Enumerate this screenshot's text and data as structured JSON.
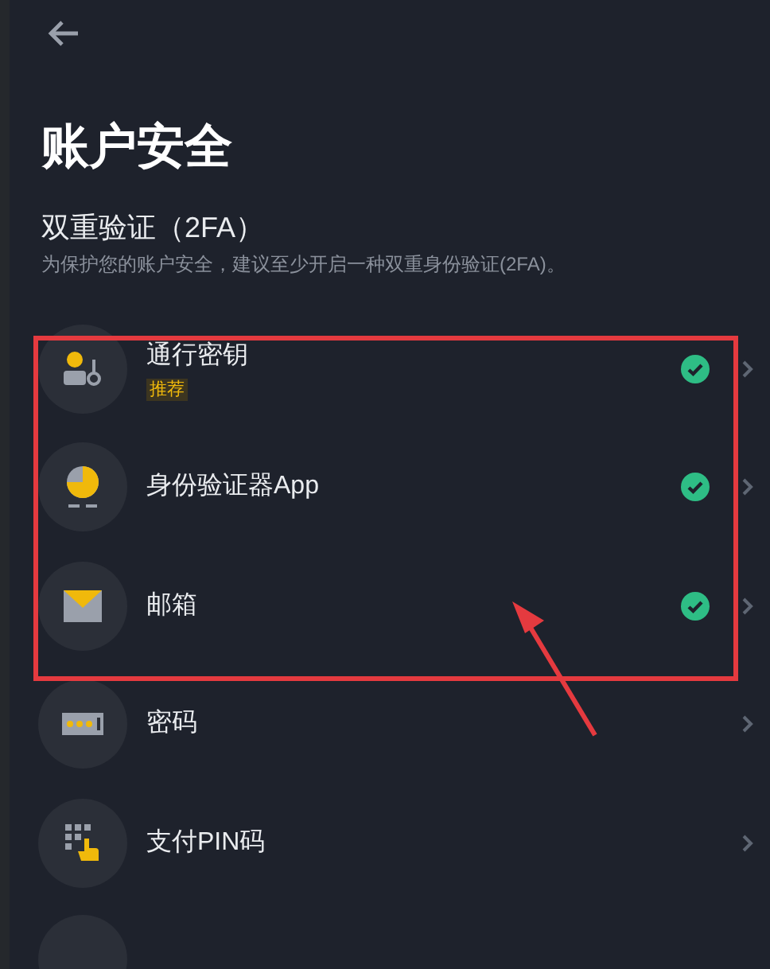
{
  "header": {
    "title": "账户安全"
  },
  "two_factor": {
    "heading": "双重验证（2FA）",
    "description": "为保护您的账户安全，建议至少开启一种双重身份验证(2FA)。",
    "items": [
      {
        "kind": "passkey",
        "label": "通行密钥",
        "badge": "推荐",
        "enabled": true
      },
      {
        "kind": "authenticator",
        "label": "身份验证器App",
        "enabled": true
      },
      {
        "kind": "email",
        "label": "邮箱",
        "enabled": true
      }
    ]
  },
  "other_items": [
    {
      "kind": "password",
      "label": "密码"
    },
    {
      "kind": "pin",
      "label": "支付PIN码"
    }
  ]
}
